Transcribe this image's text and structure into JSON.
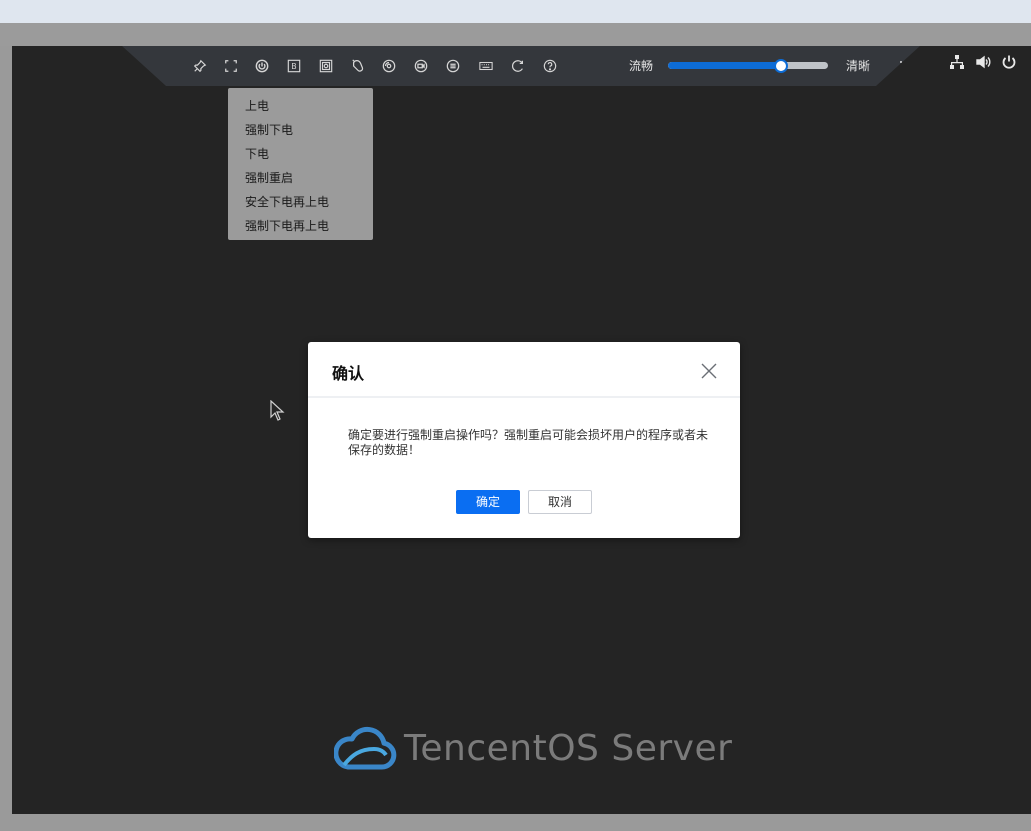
{
  "toolbar": {
    "icons": [
      "pin-icon",
      "fullscreen-icon",
      "power-icon",
      "boot-icon",
      "screenshot-icon",
      "mouse-icon",
      "media-icon",
      "record-icon",
      "menu-list-icon",
      "keyboard-icon",
      "refresh-icon",
      "help-icon"
    ],
    "quality_left_label": "流畅",
    "quality_right_label": "清晰",
    "quality_level": 0.7
  },
  "status": {
    "icons": [
      "network-icon",
      "volume-icon",
      "power-status-icon"
    ]
  },
  "power_menu": {
    "items": [
      "上电",
      "强制下电",
      "下电",
      "强制重启",
      "安全下电再上电",
      "强制下电再上电"
    ]
  },
  "dialog": {
    "title": "确认",
    "message": "确定要进行强制重启操作吗？强制重启可能会损坏用户的程序或者未保存的数据！",
    "ok_label": "确定",
    "cancel_label": "取消"
  },
  "logo": {
    "text": "TencentOS Server"
  },
  "colors": {
    "accent": "#0a6ef2",
    "screen_bg": "#242424",
    "toolbar_bg": "#34373c"
  }
}
